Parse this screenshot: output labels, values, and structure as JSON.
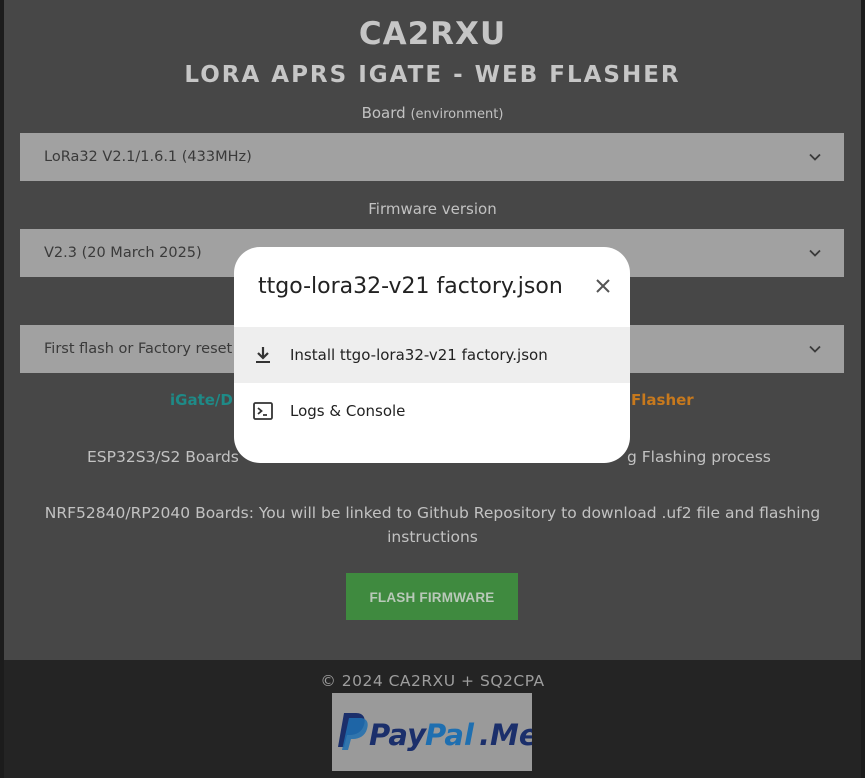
{
  "header": {
    "title": "CA2RXU",
    "subtitle": "LORA APRS IGATE - WEB FLASHER"
  },
  "board": {
    "label": "Board",
    "label_suffix": "(environment)",
    "selected": "LoRa32 V2.1/1.6.1 (433MHz)"
  },
  "firmware": {
    "label": "Firmware version",
    "selected": "V2.3 (20 March 2025)"
  },
  "flash_mode": {
    "selected": "First flash or Factory reset ("
  },
  "links": {
    "left_text": "iGate/D",
    "right_text": "Flasher"
  },
  "info": {
    "esp32_left": "ESP32S3/S2 Boards",
    "esp32_right": "g Flashing process",
    "nrf": "NRF52840/RP2040 Boards: You will be linked to Github Repository to download .uf2 file and flashing",
    "nrf_line2": "instructions"
  },
  "flash_button": {
    "label": "FLASH FIRMWARE"
  },
  "footer": {
    "copyright": "© 2024 CA2RXU + SQ2CPA",
    "paypal_logo": "PayPal.Me"
  },
  "dialog": {
    "title": "ttgo-lora32-v21 factory.json",
    "items": [
      {
        "label": "Install ttgo-lora32-v21 factory.json",
        "icon": "download-icon"
      },
      {
        "label": "Logs & Console",
        "icon": "console-icon"
      }
    ]
  },
  "colors": {
    "flash_button": "#3f8a3f",
    "link_teal": "#1e8a87",
    "link_orange": "#c7791d",
    "paypal_dark": "#1b2f6b",
    "paypal_light": "#1f6fb0"
  }
}
